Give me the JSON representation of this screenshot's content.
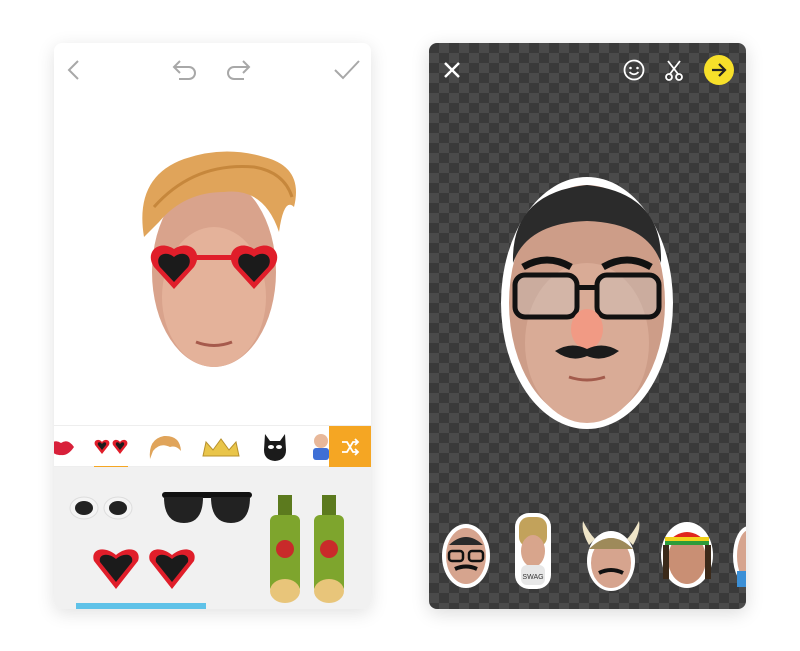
{
  "left_screen": {
    "toolbar": {
      "back_icon": "chevron-left-icon",
      "undo_icon": "undo-icon",
      "redo_icon": "redo-icon",
      "done_icon": "checkmark-icon"
    },
    "categories": [
      {
        "icon": "lips-icon"
      },
      {
        "icon": "heart-sunglasses-icon",
        "active": true
      },
      {
        "icon": "hair-icon"
      },
      {
        "icon": "crown-icon"
      },
      {
        "icon": "mask-icon"
      },
      {
        "icon": "character-icon"
      }
    ],
    "shuffle_icon": "shuffle-icon",
    "accent_color": "#f5a623",
    "stickers": [
      {
        "icon": "white-sunglasses-icon"
      },
      {
        "icon": "black-sunglasses-icon"
      },
      {
        "icon": "beer-bottle-glasses-icon"
      },
      {
        "icon": "red-heart-sunglasses-icon"
      },
      {
        "icon": "palm-flamingo-glasses-icon"
      },
      {
        "icon": "aviator-sunglasses-icon"
      }
    ]
  },
  "right_screen": {
    "toolbar": {
      "close_icon": "close-icon",
      "emoji_icon": "smiley-icon",
      "cut_icon": "scissors-icon",
      "next_icon": "arrow-right-icon",
      "next_color": "#f7e02a"
    },
    "faces": [
      {
        "icon": "groucho-face-icon"
      },
      {
        "icon": "bird-costume-face-icon",
        "label": "SWAG"
      },
      {
        "icon": "viking-face-icon"
      },
      {
        "icon": "rasta-face-icon"
      },
      {
        "icon": "partial-face-icon"
      }
    ]
  }
}
